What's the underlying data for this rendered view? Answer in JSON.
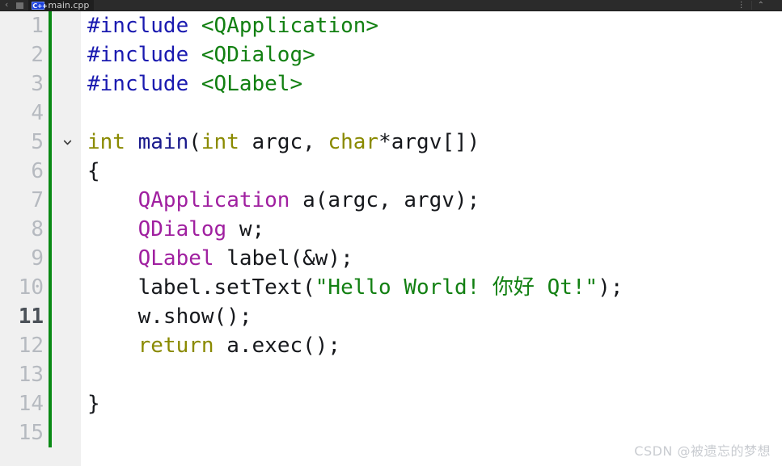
{
  "tabbar": {
    "nav_back_label": "‹",
    "nav_forward_label": "›",
    "stop_label": "",
    "file_icon_label": "C++",
    "active_tab_title": "main.cpp",
    "right_items": [
      {
        "label": "⋮"
      },
      {
        "label": "⌃"
      },
      {
        "label": ""
      }
    ]
  },
  "editor": {
    "language": "C++",
    "current_line": 11,
    "change_marker_color": "#0a8a15",
    "gutter_bg": "#f0f0f0",
    "code_bg": "#ffffff",
    "lines": [
      {
        "no": "1",
        "fold": "",
        "tokens": [
          {
            "t": "#include",
            "c": "t-pre"
          },
          {
            "t": " ",
            "c": "t-plain"
          },
          {
            "t": "<QApplication>",
            "c": "t-inc"
          }
        ]
      },
      {
        "no": "2",
        "fold": "",
        "tokens": [
          {
            "t": "#include",
            "c": "t-pre"
          },
          {
            "t": " ",
            "c": "t-plain"
          },
          {
            "t": "<QDialog>",
            "c": "t-inc"
          }
        ]
      },
      {
        "no": "3",
        "fold": "",
        "tokens": [
          {
            "t": "#include",
            "c": "t-pre"
          },
          {
            "t": " ",
            "c": "t-plain"
          },
          {
            "t": "<QLabel>",
            "c": "t-inc"
          }
        ]
      },
      {
        "no": "4",
        "fold": "",
        "tokens": []
      },
      {
        "no": "5",
        "fold": "chevron-down",
        "tokens": [
          {
            "t": "int",
            "c": "t-kw"
          },
          {
            "t": " ",
            "c": "t-plain"
          },
          {
            "t": "main",
            "c": "t-fn"
          },
          {
            "t": "(",
            "c": "t-punct"
          },
          {
            "t": "int",
            "c": "t-kw"
          },
          {
            "t": " argc, ",
            "c": "t-plain"
          },
          {
            "t": "char",
            "c": "t-kw"
          },
          {
            "t": "*argv[])",
            "c": "t-plain"
          }
        ]
      },
      {
        "no": "6",
        "fold": "",
        "tokens": [
          {
            "t": "{",
            "c": "t-punct"
          }
        ]
      },
      {
        "no": "7",
        "fold": "",
        "tokens": [
          {
            "t": "    ",
            "c": "t-plain"
          },
          {
            "t": "QApplication",
            "c": "t-type"
          },
          {
            "t": " a(argc, argv);",
            "c": "t-plain"
          }
        ]
      },
      {
        "no": "8",
        "fold": "",
        "tokens": [
          {
            "t": "    ",
            "c": "t-plain"
          },
          {
            "t": "QDialog",
            "c": "t-type"
          },
          {
            "t": " w;",
            "c": "t-plain"
          }
        ]
      },
      {
        "no": "9",
        "fold": "",
        "tokens": [
          {
            "t": "    ",
            "c": "t-plain"
          },
          {
            "t": "QLabel",
            "c": "t-type"
          },
          {
            "t": " label(&w);",
            "c": "t-plain"
          }
        ]
      },
      {
        "no": "10",
        "fold": "",
        "tokens": [
          {
            "t": "    label.setText(",
            "c": "t-plain"
          },
          {
            "t": "\"Hello World! 你好 Qt!\"",
            "c": "t-str"
          },
          {
            "t": ");",
            "c": "t-plain"
          }
        ]
      },
      {
        "no": "11",
        "fold": "",
        "tokens": [
          {
            "t": "    w.show();",
            "c": "t-plain"
          }
        ]
      },
      {
        "no": "12",
        "fold": "",
        "tokens": [
          {
            "t": "    ",
            "c": "t-plain"
          },
          {
            "t": "return",
            "c": "t-kw"
          },
          {
            "t": " a.exec();",
            "c": "t-plain"
          }
        ]
      },
      {
        "no": "13",
        "fold": "",
        "tokens": []
      },
      {
        "no": "14",
        "fold": "",
        "tokens": [
          {
            "t": "}",
            "c": "t-punct"
          }
        ]
      },
      {
        "no": "15",
        "fold": "",
        "tokens": []
      }
    ]
  },
  "watermark": {
    "text": "CSDN @被遗忘的梦想"
  }
}
